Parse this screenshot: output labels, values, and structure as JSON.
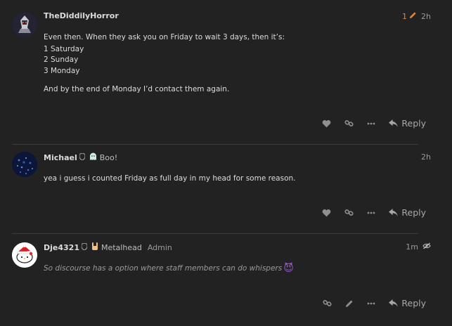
{
  "posts": [
    {
      "username": "TheDiddilyHorror",
      "edit_count": "1",
      "time": "2h",
      "paragraphs": [
        "Even then. When they ask you on Friday to wait 3 days, then it’s:",
        "1 Saturday",
        "2 Sunday",
        "3 Monday",
        "And by the end of Monday I’d contact them again."
      ],
      "reply_label": "Reply"
    },
    {
      "username": "Michael",
      "flair_text": "Boo!",
      "time": "2h",
      "paragraphs": [
        "yea i guess i counted Friday as full day in my head for some reason."
      ],
      "reply_label": "Reply"
    },
    {
      "username": "Dje4321",
      "flair_text": "Metalhead",
      "user_title": "Admin",
      "time": "1m",
      "paragraphs": [
        "So discourse has a option where staff members can do whispers"
      ],
      "emoji": "😈",
      "reply_label": "Reply"
    }
  ],
  "colors": {
    "accent_edit": "#e9842d",
    "background": "#222222"
  }
}
